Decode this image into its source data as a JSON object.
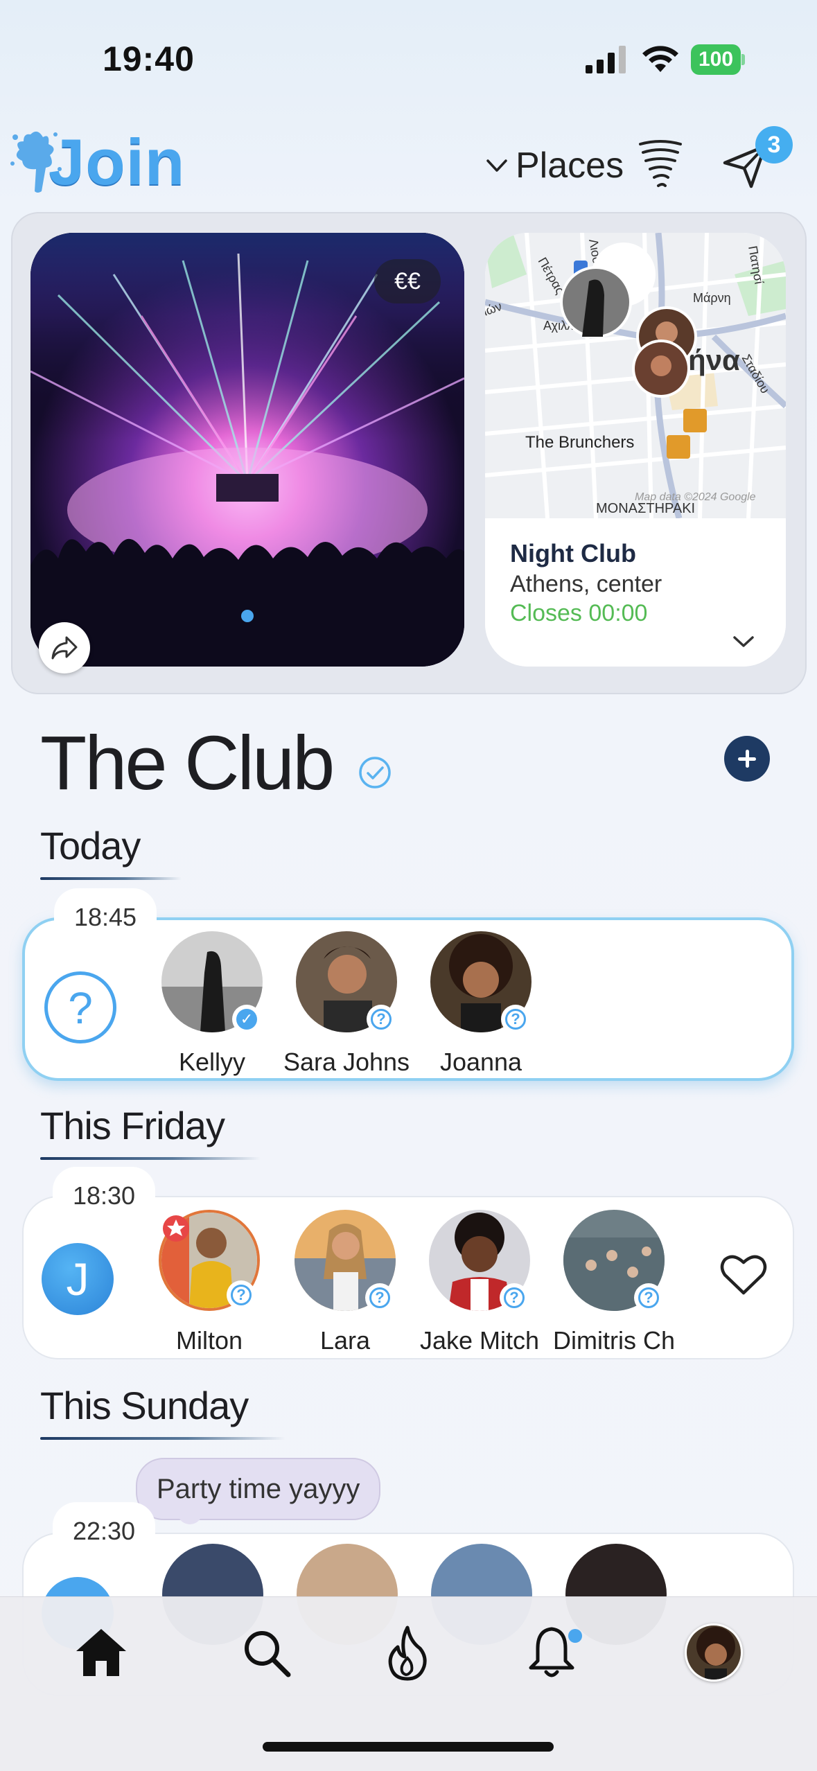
{
  "status_bar": {
    "time": "19:40",
    "battery": "100"
  },
  "header": {
    "logo_text": "Join",
    "places_label": "Places",
    "notifications_badge": "3"
  },
  "hero": {
    "price_level": "€€",
    "carousel": {
      "count": 1,
      "active": 1
    },
    "map": {
      "city_label": "Αθήνα",
      "place_label": "The Brunchers",
      "watermark": "Map data ©2024 Google",
      "street_labels": [
        "Πέτρας",
        "Λιοσίων",
        "Πατησί",
        "Αχιλλέως",
        "Μάρνη",
        "Σταδίου",
        "ΜΟΝΑΣΤΗΡΑΚΙ",
        "ιών"
      ]
    },
    "venue": {
      "type": "Night Club",
      "area": "Athens, center",
      "hours": "Closes 00:00"
    }
  },
  "title": "The Club",
  "sections": [
    {
      "label": "Today",
      "time": "18:45",
      "host": "?",
      "attendees": [
        {
          "name": "Kellyy",
          "status": "confirmed"
        },
        {
          "name": "Sara Johns",
          "status": "pending"
        },
        {
          "name": "Joanna",
          "status": "pending"
        }
      ]
    },
    {
      "label": "This Friday",
      "time": "18:30",
      "host": "J",
      "attendees": [
        {
          "name": "Milton",
          "status": "pending"
        },
        {
          "name": "Lara",
          "status": "pending"
        },
        {
          "name": "Jake Mitch",
          "status": "pending"
        },
        {
          "name": "Dimitris Ch",
          "status": "pending"
        }
      ]
    },
    {
      "label": "This Sunday",
      "time": "22:30",
      "message": "Party time yayyy"
    }
  ],
  "tabbar": [
    "home-icon",
    "search-icon",
    "flame-icon",
    "bell-icon",
    "profile-avatar"
  ],
  "colors": {
    "accent": "#4aa6ee",
    "navy": "#1e3a63",
    "open_green": "#55bb55"
  }
}
